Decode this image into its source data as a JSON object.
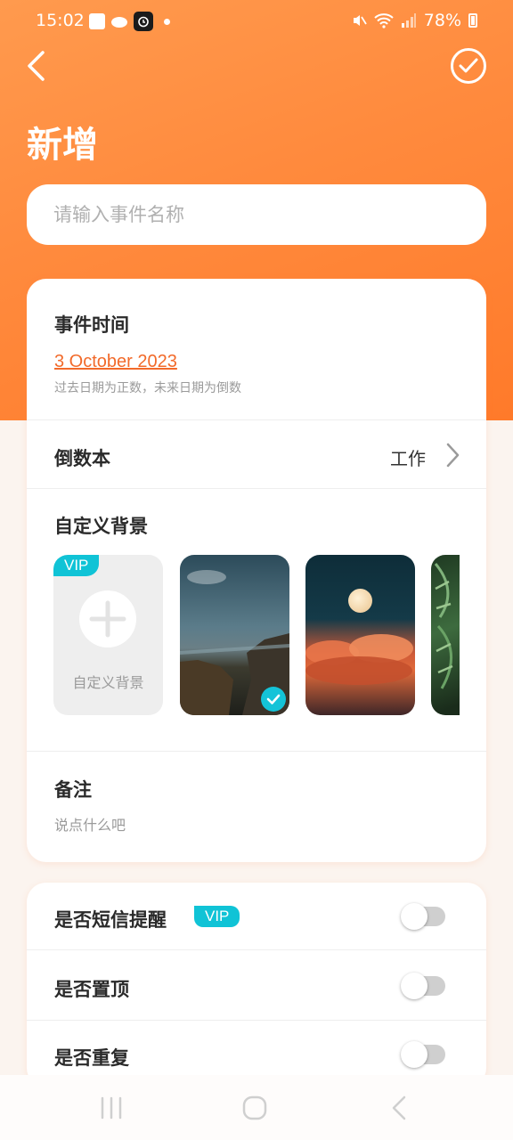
{
  "status_bar": {
    "time": "15:02",
    "battery": "78%",
    "left_icons": [
      "gallery-icon",
      "cloud-icon",
      "alarm-icon",
      "dot"
    ],
    "right_icons": [
      "mute-icon",
      "wifi-icon",
      "signal-icon",
      "battery-icon"
    ]
  },
  "header": {
    "title": "新增",
    "back_icon": "chevron-left-icon",
    "confirm_icon": "check-circle-icon"
  },
  "name_input": {
    "placeholder": "请输入事件名称",
    "value": ""
  },
  "event_time": {
    "label": "事件时间",
    "date": "3 October 2023",
    "hint": "过去日期为正数，未来日期为倒数"
  },
  "countdown_book": {
    "label": "倒数本",
    "value": "工作"
  },
  "custom_background": {
    "label": "自定义背景",
    "custom_label": "自定义背景",
    "vip_badge": "VIP",
    "images": [
      {
        "name": "coast",
        "selected": true
      },
      {
        "name": "moon-clouds",
        "selected": false
      },
      {
        "name": "leaves",
        "selected": false
      }
    ]
  },
  "notes": {
    "label": "备注",
    "placeholder": "说点什么吧"
  },
  "settings": [
    {
      "label": "是否短信提醒",
      "vip": "VIP",
      "enabled": false
    },
    {
      "label": "是否置顶",
      "enabled": false
    },
    {
      "label": "是否重复",
      "enabled": false
    }
  ],
  "colors": {
    "accent": "#ff8a3d",
    "link": "#f26a2a",
    "vip": "#10c3d6",
    "background": "#fbf4ef"
  }
}
